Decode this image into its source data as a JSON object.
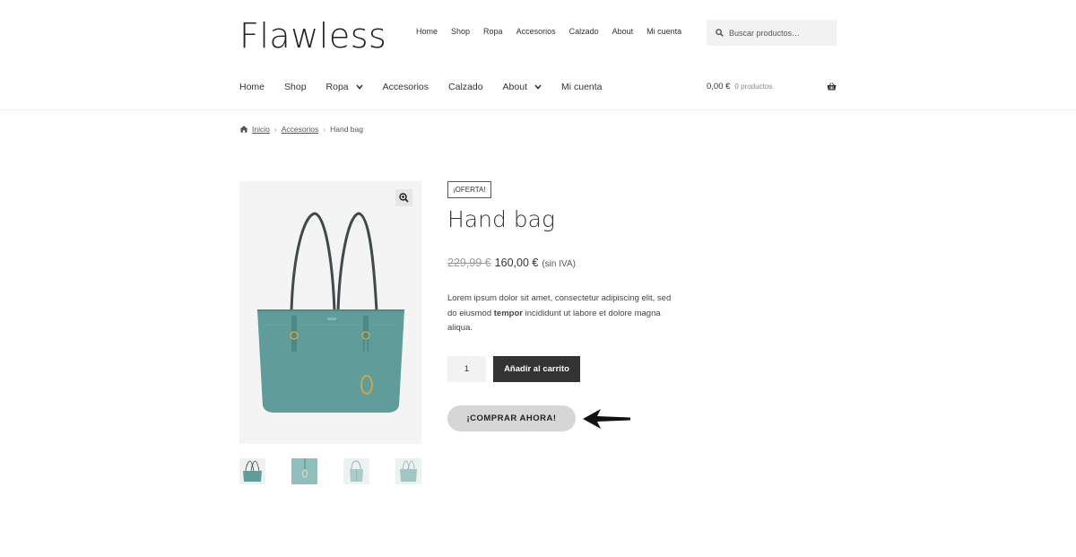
{
  "site": {
    "logo": "Flawless"
  },
  "top_nav": [
    "Home",
    "Shop",
    "Ropa",
    "Accesorios",
    "Calzado",
    "About",
    "Mi cuenta"
  ],
  "search": {
    "placeholder": "Buscar productos…"
  },
  "main_nav": [
    {
      "label": "Home",
      "dropdown": false
    },
    {
      "label": "Shop",
      "dropdown": false
    },
    {
      "label": "Ropa",
      "dropdown": true
    },
    {
      "label": "Accesorios",
      "dropdown": false
    },
    {
      "label": "Calzado",
      "dropdown": false
    },
    {
      "label": "About",
      "dropdown": true
    },
    {
      "label": "Mi cuenta",
      "dropdown": false
    }
  ],
  "cart": {
    "total": "0,00 €",
    "count": "0 productos"
  },
  "breadcrumb": {
    "home": "Inicio",
    "category": "Accesorios",
    "current": "Hand bag"
  },
  "product": {
    "badge": "¡OFERTA!",
    "title": "Hand bag",
    "old_price": "229,99 €",
    "price": "160,00 €",
    "tax_note": "(sin IVA)",
    "description_before": "Lorem ipsum dolor sit amet, consectetur adipiscing elit, sed do eiusmod ",
    "description_bold": "tempor",
    "description_after": " incididunt ut labore et dolore magna aliqua.",
    "quantity": "1",
    "add_to_cart": "Añadir al carrito",
    "buy_now": "¡COMPRAR AHORA!"
  },
  "colors": {
    "bag": "#5f9c9a",
    "dark_button": "#333333",
    "buy_now_bg": "#d6d6d6"
  }
}
